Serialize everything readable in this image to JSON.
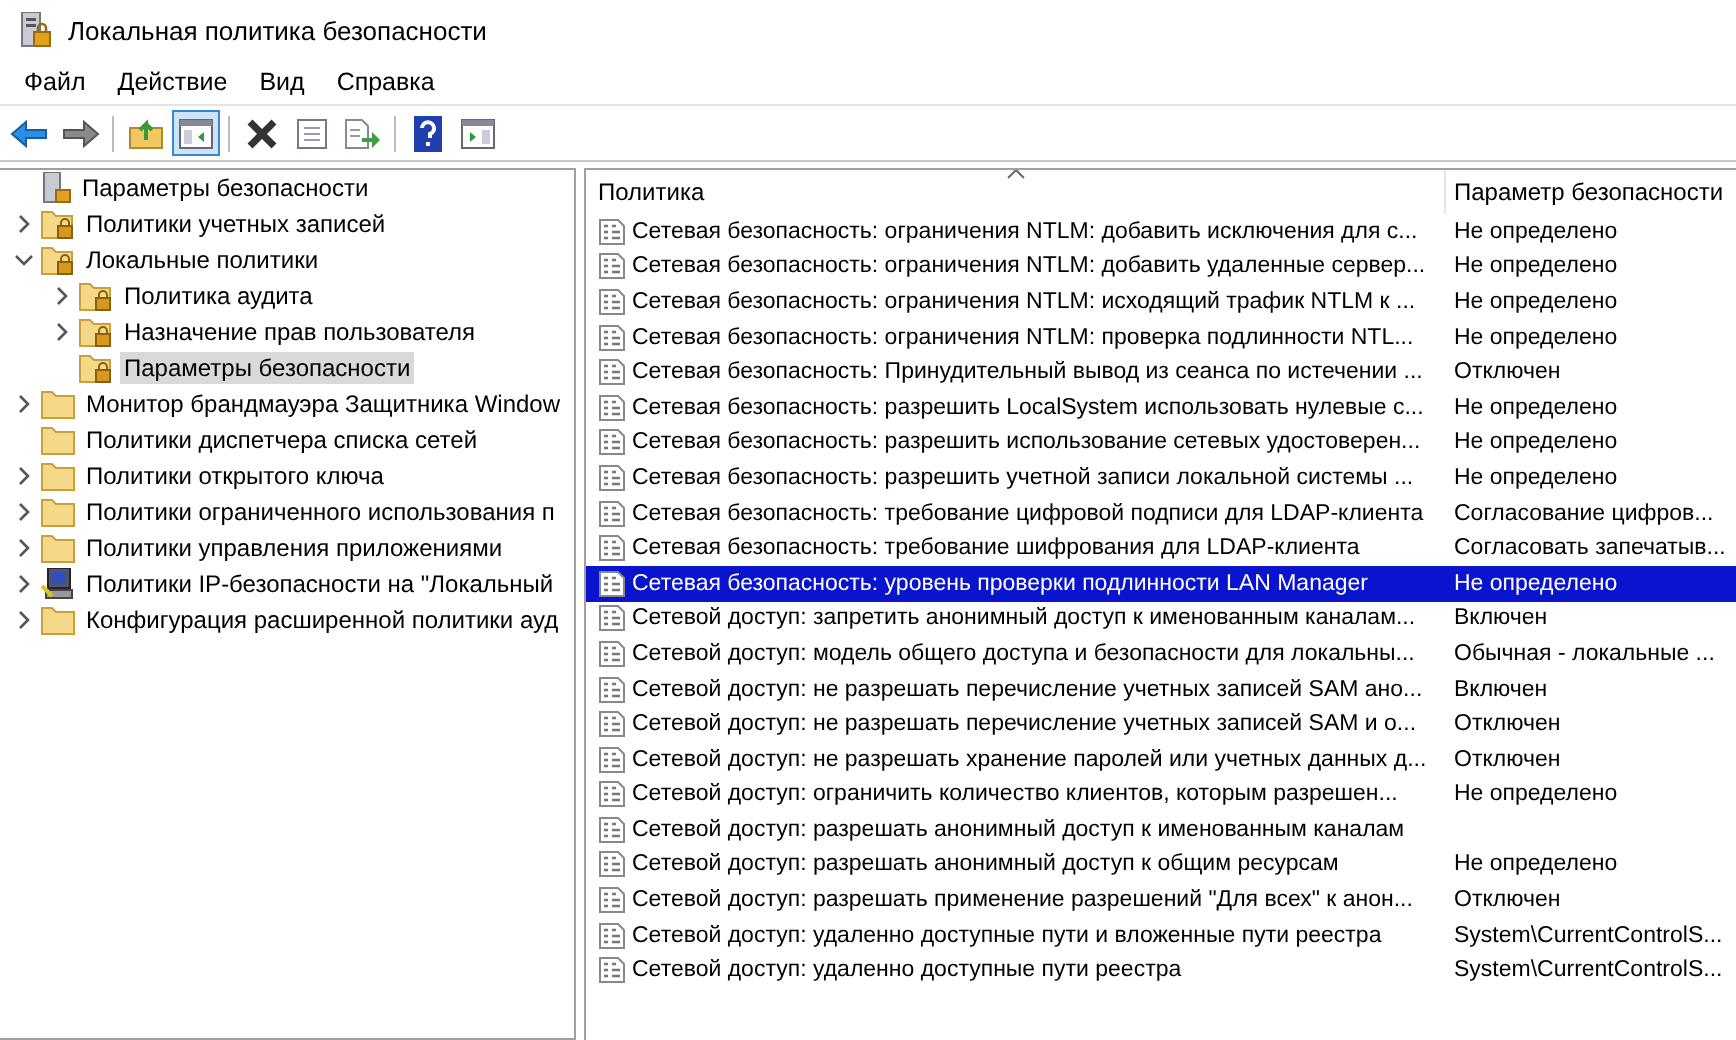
{
  "window": {
    "title": "Локальная политика безопасности"
  },
  "menu": [
    "Файл",
    "Действие",
    "Вид",
    "Справка"
  ],
  "toolbar": [
    {
      "kind": "back",
      "pressed": false
    },
    {
      "kind": "forward",
      "pressed": false
    },
    {
      "kind": "separator"
    },
    {
      "kind": "up",
      "pressed": false
    },
    {
      "kind": "tree-toggle",
      "pressed": true
    },
    {
      "kind": "separator"
    },
    {
      "kind": "delete",
      "pressed": false
    },
    {
      "kind": "properties",
      "pressed": false
    },
    {
      "kind": "export",
      "pressed": false
    },
    {
      "kind": "separator"
    },
    {
      "kind": "help",
      "pressed": false
    },
    {
      "kind": "panel",
      "pressed": false
    }
  ],
  "tree": {
    "root": "Параметры безопасности",
    "items": [
      {
        "label": "Политики учетных записей",
        "kind": "secured-folder",
        "expandable": true,
        "expanded": false,
        "selected": false
      },
      {
        "label": "Локальные политики",
        "kind": "secured-folder",
        "expandable": true,
        "expanded": true,
        "selected": false,
        "children": [
          {
            "label": "Политика аудита",
            "kind": "secured-folder",
            "expandable": true,
            "expanded": false,
            "selected": false
          },
          {
            "label": "Назначение прав пользователя",
            "kind": "secured-folder",
            "expandable": true,
            "expanded": false,
            "selected": false
          },
          {
            "label": "Параметры безопасности",
            "kind": "secured-folder",
            "selected": true
          }
        ]
      },
      {
        "label": "Монитор брандмауэра Защитника Window",
        "kind": "folder",
        "expandable": true,
        "expanded": false,
        "selected": false
      },
      {
        "label": "Политики диспетчера списка сетей",
        "kind": "folder",
        "selected": false
      },
      {
        "label": "Политики открытого ключа",
        "kind": "folder",
        "expandable": true,
        "expanded": false,
        "selected": false
      },
      {
        "label": "Политики ограниченного использования п",
        "kind": "folder",
        "expandable": true,
        "expanded": false,
        "selected": false
      },
      {
        "label": "Политики управления приложениями",
        "kind": "folder",
        "expandable": true,
        "expanded": false,
        "selected": false
      },
      {
        "label": "Политики IP-безопасности на \"Локальный",
        "kind": "computer",
        "expandable": true,
        "expanded": false,
        "selected": false
      },
      {
        "label": "Конфигурация расширенной политики ауд",
        "kind": "folder",
        "expandable": true,
        "expanded": false,
        "selected": false
      }
    ]
  },
  "table": {
    "columns": [
      "Политика",
      "Параметр безопасности"
    ],
    "rows": [
      {
        "policy": "Сетевая безопасность: ограничения NTLM: добавить исключения для с...",
        "setting": "Не определено",
        "selected": false
      },
      {
        "policy": "Сетевая безопасность: ограничения NTLM: добавить удаленные сервер...",
        "setting": "Не определено",
        "selected": false
      },
      {
        "policy": "Сетевая безопасность: ограничения NTLM: исходящий трафик NTLM к ...",
        "setting": "Не определено",
        "selected": false
      },
      {
        "policy": "Сетевая безопасность: ограничения NTLM: проверка подлинности NTL...",
        "setting": "Не определено",
        "selected": false
      },
      {
        "policy": "Сетевая безопасность: Принудительный вывод из сеанса по истечении ...",
        "setting": "Отключен",
        "selected": false
      },
      {
        "policy": "Сетевая безопасность: разрешить LocalSystem использовать нулевые с...",
        "setting": "Не определено",
        "selected": false
      },
      {
        "policy": "Сетевая безопасность: разрешить использование сетевых удостоверен...",
        "setting": "Не определено",
        "selected": false
      },
      {
        "policy": "Сетевая безопасность: разрешить учетной записи локальной системы ...",
        "setting": "Не определено",
        "selected": false
      },
      {
        "policy": "Сетевая безопасность: требование цифровой подписи для LDAP-клиента",
        "setting": "Согласование цифров...",
        "selected": false
      },
      {
        "policy": "Сетевая безопасность: требование шифрования для LDAP-клиента",
        "setting": "Согласовать запечатыв...",
        "selected": false
      },
      {
        "policy": "Сетевая безопасность: уровень проверки подлинности LAN Manager",
        "setting": "Не определено",
        "selected": true
      },
      {
        "policy": "Сетевой доступ: запретить анонимный доступ к именованным каналам...",
        "setting": "Включен",
        "selected": false
      },
      {
        "policy": "Сетевой доступ: модель общего доступа и безопасности для локальны...",
        "setting": "Обычная - локальные ...",
        "selected": false
      },
      {
        "policy": "Сетевой доступ: не разрешать перечисление учетных записей SAM ано...",
        "setting": "Включен",
        "selected": false
      },
      {
        "policy": "Сетевой доступ: не разрешать перечисление учетных записей SAM и о...",
        "setting": "Отключен",
        "selected": false
      },
      {
        "policy": "Сетевой доступ: не разрешать хранение паролей или учетных данных д...",
        "setting": "Отключен",
        "selected": false
      },
      {
        "policy": "Сетевой доступ: ограничить количество клиентов, которым разрешен...",
        "setting": "Не определено",
        "selected": false
      },
      {
        "policy": "Сетевой доступ: разрешать анонимный доступ к именованным каналам",
        "selected": false
      },
      {
        "policy": "Сетевой доступ: разрешать анонимный доступ к общим ресурсам",
        "setting": "Не определено",
        "selected": false
      },
      {
        "policy": "Сетевой доступ: разрешать применение разрешений \"Для всех\" к анон...",
        "setting": "Отключен",
        "selected": false
      },
      {
        "policy": "Сетевой доступ: удаленно доступные пути и вложенные пути реестра",
        "setting": "System\\CurrentControlS...",
        "selected": false
      },
      {
        "policy": "Сетевой доступ: удаленно доступные пути реестра",
        "setting": "System\\CurrentControlS...",
        "selected": false
      }
    ]
  }
}
